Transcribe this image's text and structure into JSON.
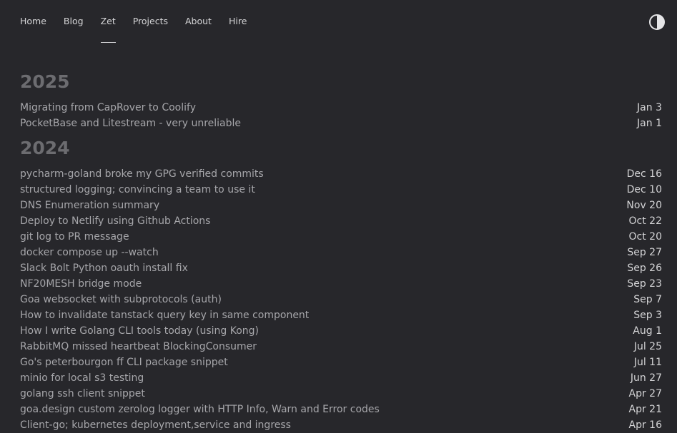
{
  "nav": {
    "items": [
      {
        "label": "Home"
      },
      {
        "label": "Blog"
      },
      {
        "label": "Zet"
      },
      {
        "label": "Projects"
      },
      {
        "label": "About"
      },
      {
        "label": "Hire"
      }
    ],
    "active": "Zet",
    "theme_toggle_icon": "contrast-icon"
  },
  "colors": {
    "background": "#27272b",
    "nav_text": "#d4d4d6",
    "year_heading": "#6c6c70",
    "post_title": "#a6a6aa",
    "post_date": "#d4d4d6"
  },
  "years": [
    {
      "year": "2025",
      "posts": [
        {
          "title": "Migrating from CapRover to Coolify",
          "date": "Jan 3"
        },
        {
          "title": "PocketBase and Litestream - very unreliable",
          "date": "Jan 1"
        }
      ]
    },
    {
      "year": "2024",
      "posts": [
        {
          "title": "pycharm-goland broke my GPG verified commits",
          "date": "Dec 16"
        },
        {
          "title": "structured logging; convincing a team to use it",
          "date": "Dec 10"
        },
        {
          "title": "DNS Enumeration summary",
          "date": "Nov 20"
        },
        {
          "title": "Deploy to Netlify using Github Actions",
          "date": "Oct 22"
        },
        {
          "title": "git log to PR message",
          "date": "Oct 20"
        },
        {
          "title": "docker compose up --watch",
          "date": "Sep 27"
        },
        {
          "title": "Slack Bolt Python oauth install fix",
          "date": "Sep 26"
        },
        {
          "title": "NF20MESH bridge mode",
          "date": "Sep 23"
        },
        {
          "title": "Goa websocket with subprotocols (auth)",
          "date": "Sep 7"
        },
        {
          "title": "How to invalidate tanstack query key in same component",
          "date": "Sep 3"
        },
        {
          "title": "How I write Golang CLI tools today (using Kong)",
          "date": "Aug 1"
        },
        {
          "title": "RabbitMQ missed heartbeat BlockingConsumer",
          "date": "Jul 25"
        },
        {
          "title": "Go's peterbourgon ff CLI package snippet",
          "date": "Jul 11"
        },
        {
          "title": "minio for local s3 testing",
          "date": "Jun 27"
        },
        {
          "title": "golang ssh client snippet",
          "date": "Apr 27"
        },
        {
          "title": "goa.design custom zerolog logger with HTTP Info, Warn and Error codes",
          "date": "Apr 21"
        },
        {
          "title": "Client-go; kubernetes deployment,service and ingress",
          "date": "Apr 16"
        }
      ]
    }
  ]
}
